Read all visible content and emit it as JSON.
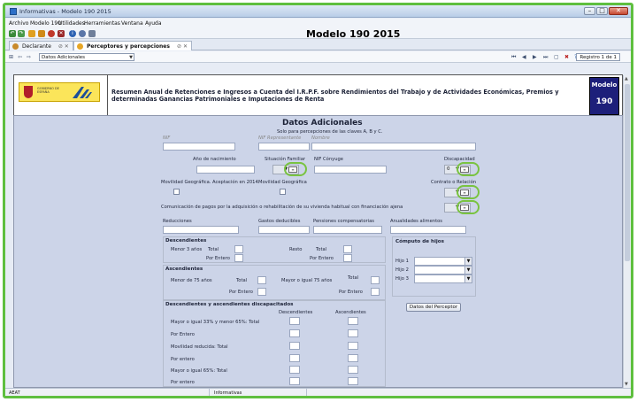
{
  "window": {
    "title": "Informativas - Modelo 190 2015"
  },
  "menu": [
    "Archivo",
    "Modelo 190",
    "Utilidades",
    "Herramientas",
    "Ventana",
    "Ayuda"
  ],
  "app_title": "Modelo 190 2015",
  "tabs": [
    {
      "label": "Declarante"
    },
    {
      "label": "Perceptores y percepciones"
    }
  ],
  "nav": {
    "combo_value": "Datos Adicionales",
    "registro": "Registro 1 de 1"
  },
  "header": {
    "logo_text": "GOBIERNO DE ESPAÑA",
    "description": "Resumen Anual de Retenciones e Ingresos a Cuenta del I.R.P.F. sobre Rendimientos del Trabajo y de Actividades Económicas, Premios y determinadas Ganancias Patrimoniales e Imputaciones de Renta",
    "modelo_label": "Modelo",
    "modelo_number": "190"
  },
  "form": {
    "title": "Datos Adicionales",
    "subtitle": "Solo para percepciones de las claves A, B y C.",
    "faded": {
      "nif": "NIF",
      "nif_rep": "NIF Representante",
      "nombre": "Nombre"
    },
    "labels": {
      "anio_nacimiento": "Año de nacimiento",
      "situacion_familiar": "Situación Familiar",
      "nif_conyuge": "NIF Cónyuge",
      "discapacidad": "Discapacidad",
      "movilidad_aceptacion": "Movilidad Geográfica. Aceptación en 2014.",
      "movilidad": "Movilidad Geográfica",
      "contrato": "Contrato o Relación",
      "comunicacion": "Comunicación de pagos por la adquisición o rehabilitación de su vivienda habitual con financiación ajena",
      "reducciones": "Reducciones",
      "gastos": "Gastos deducibles",
      "pensiones": "Pensiones compensatorias",
      "anualidades": "Anualidades alimentos"
    },
    "discapacidad_value": "0",
    "descendientes": {
      "title": "Descendientes",
      "menor3": "Menor 3 años",
      "resto": "Resto",
      "total": "Total",
      "por_entero": "Por Entero"
    },
    "ascendientes": {
      "title": "Ascendientes",
      "menor75": "Menor de 75 años",
      "mayor75": "Mayor o igual 75 años",
      "total": "Total",
      "por_entero": "Por Entero"
    },
    "computo": {
      "title": "Cómputo de hijos",
      "hijos": [
        "Hijo 1",
        "Hijo 2",
        "Hijo 3"
      ]
    },
    "datos_perceptor_button": "Datos del Perceptor",
    "discapacitados": {
      "title": "Descendientes y ascendientes discapacitados",
      "col_desc": "Descendientes",
      "col_asc": "Ascendientes",
      "rows": [
        "Mayor o igual 33% y menor 65%: Total",
        "Por Entero",
        "Movilidad reducida: Total",
        "Por entero",
        "Mayor o igual 65%: Total",
        "Por entero"
      ]
    }
  },
  "status": {
    "left": "AEAT",
    "center": "Informativas"
  }
}
